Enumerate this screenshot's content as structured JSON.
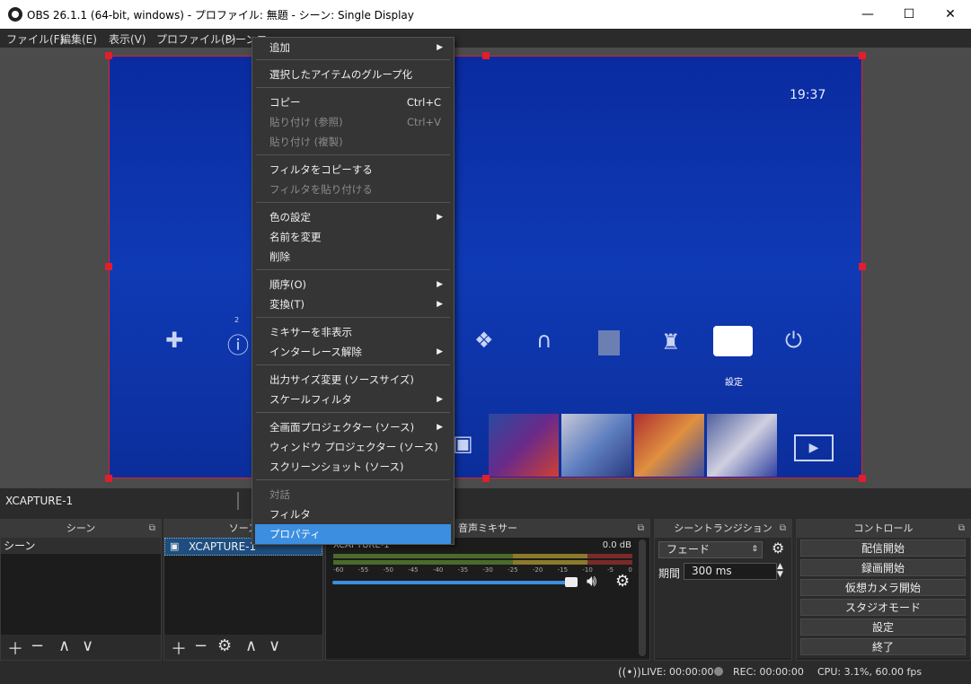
{
  "window": {
    "title": "OBS 26.1.1 (64-bit, windows) - プロファイル: 無題 - シーン: Single Display",
    "minimize": "—",
    "maximize": "☐",
    "close": "✕"
  },
  "menubar": [
    "ファイル(F)",
    "編集(E)",
    "表示(V)",
    "プロファイル(P)",
    "シーンコ"
  ],
  "preview": {
    "clock": "19:37",
    "badge": "2",
    "settings_label": "設定",
    "icons": [
      "plus-icon",
      "info-icon",
      "chat-icon",
      "headset-icon",
      "avatar",
      "trophy-icon",
      "toolbox-icon",
      "power-icon",
      "library-icon",
      "play-icon"
    ],
    "colors": {
      "screen": "#0f3ab5",
      "selection": "#e01e2c"
    }
  },
  "context_menu": {
    "items": [
      {
        "label": "追加",
        "submenu": true
      },
      {
        "label": "選択したアイテムのグループ化"
      },
      {
        "label": "コピー",
        "shortcut": "Ctrl+C"
      },
      {
        "label": "貼り付け (参照)",
        "shortcut": "Ctrl+V",
        "disabled": true
      },
      {
        "label": "貼り付け (複製)",
        "disabled": true
      },
      {
        "label": "フィルタをコピーする"
      },
      {
        "label": "フィルタを貼り付ける",
        "disabled": true
      },
      {
        "label": "色の設定",
        "submenu": true
      },
      {
        "label": "名前を変更"
      },
      {
        "label": "削除"
      },
      {
        "label": "順序(O)",
        "submenu": true
      },
      {
        "label": "変換(T)",
        "submenu": true
      },
      {
        "label": "ミキサーを非表示"
      },
      {
        "label": "インターレース解除",
        "submenu": true
      },
      {
        "label": "出力サイズ変更 (ソースサイズ)"
      },
      {
        "label": "スケールフィルタ",
        "submenu": true
      },
      {
        "label": "全画面プロジェクター (ソース)",
        "submenu": true
      },
      {
        "label": "ウィンドウ プロジェクター (ソース)"
      },
      {
        "label": "スクリーンショット (ソース)"
      },
      {
        "label": "対話",
        "disabled": true
      },
      {
        "label": "フィルタ"
      },
      {
        "label": "プロパティ",
        "active": true
      }
    ],
    "highlight_color": "#3b8ee0"
  },
  "selected_source_name": "XCAPTURE-1",
  "docks": {
    "scenes": {
      "title": "シーン",
      "items": [
        "シーン"
      ]
    },
    "sources": {
      "title": "ソース",
      "items": [
        "XCAPTURE-1"
      ]
    },
    "mixer": {
      "title": "音声ミキサー",
      "channel": "XCAPTURE-1",
      "level": "0.0 dB",
      "scale": [
        "-60",
        "-55",
        "-50",
        "-45",
        "-40",
        "-35",
        "-30",
        "-25",
        "-20",
        "-15",
        "-10",
        "-5",
        "0"
      ],
      "volume_fraction": 1.0
    },
    "transitions": {
      "title": "シーントランジション",
      "type": "フェード",
      "duration_label": "期間",
      "duration_value": "300 ms"
    },
    "controls": {
      "title": "コントロール",
      "buttons": [
        "配信開始",
        "録画開始",
        "仮想カメラ開始",
        "スタジオモード",
        "設定",
        "終了"
      ]
    }
  },
  "status": {
    "live": "LIVE: 00:00:00",
    "rec": "REC: 00:00:00",
    "cpu": "CPU: 3.1%, 60.00 fps"
  }
}
